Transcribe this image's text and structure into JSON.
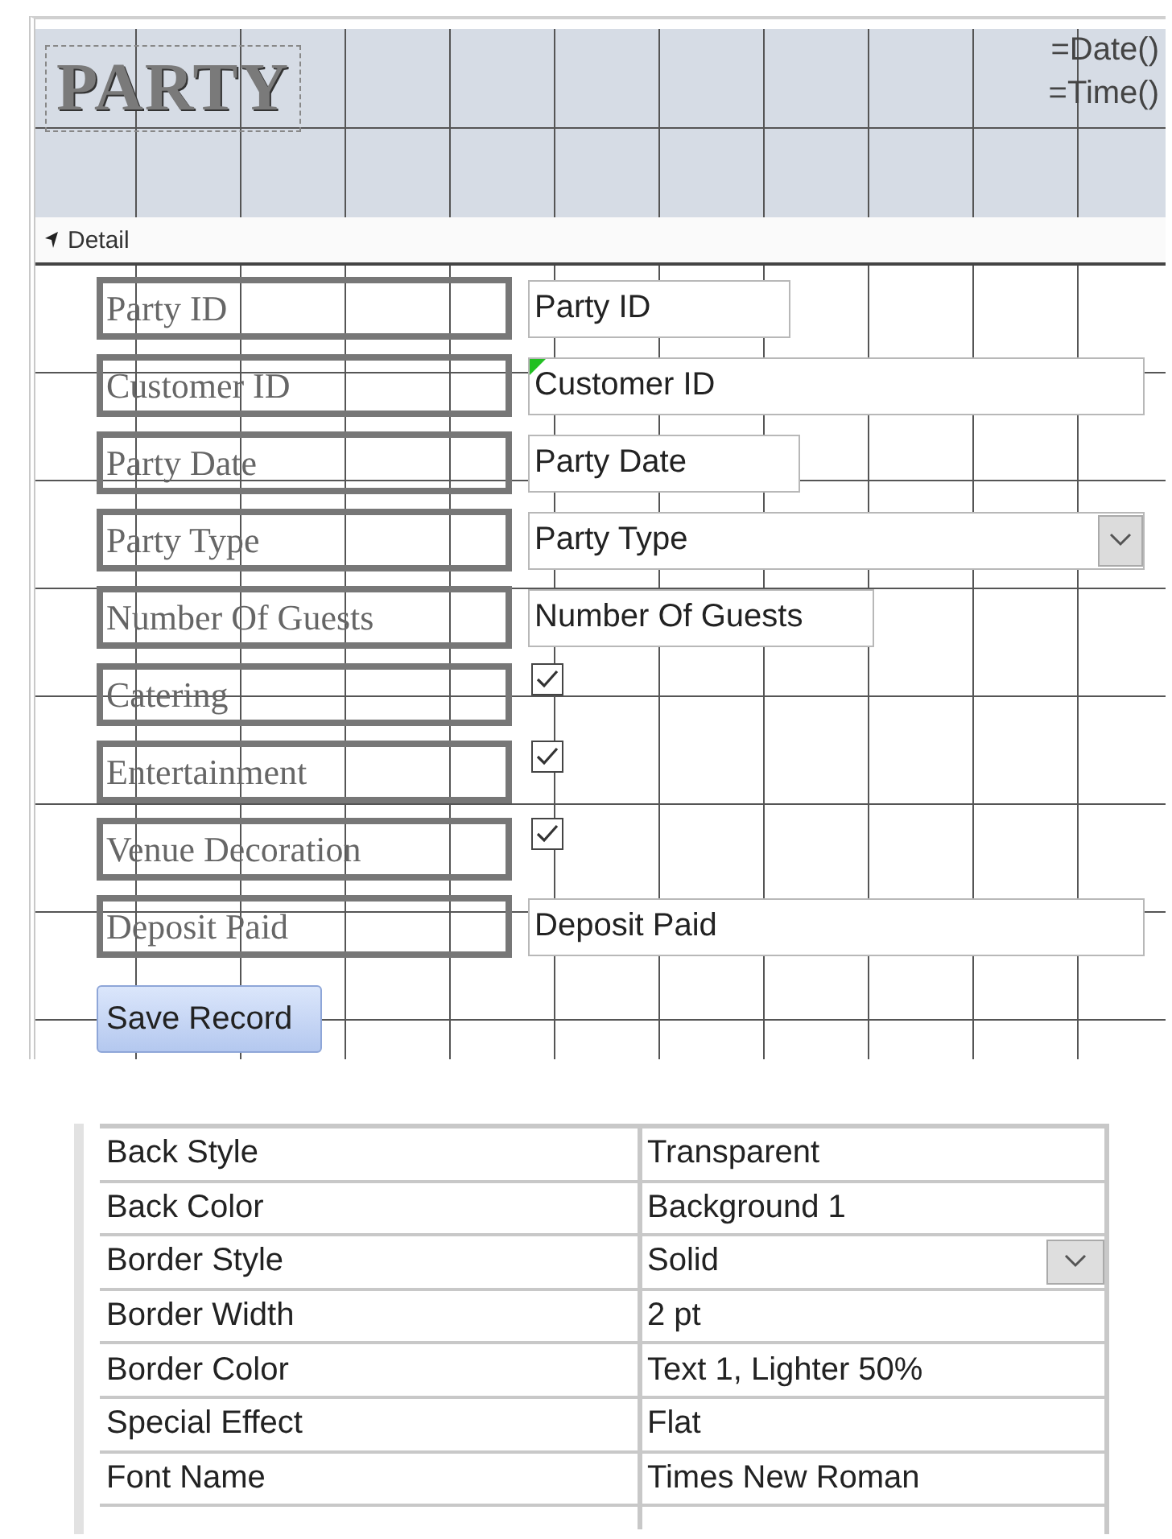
{
  "header": {
    "title": "PARTY",
    "expressions": [
      "=Date()",
      "=Time()"
    ]
  },
  "section": {
    "label": "Detail"
  },
  "fields": [
    {
      "label": "Party ID",
      "kind": "text",
      "value": "Party ID"
    },
    {
      "label": "Customer ID",
      "kind": "text",
      "value": "Customer ID",
      "error_flag": true
    },
    {
      "label": "Party Date",
      "kind": "text",
      "value": "Party Date"
    },
    {
      "label": "Party Type",
      "kind": "combo",
      "value": "Party Type"
    },
    {
      "label": "Number Of Guests",
      "kind": "text",
      "value": "Number Of Guests"
    },
    {
      "label": "Catering",
      "kind": "checkbox",
      "checked": true
    },
    {
      "label": "Entertainment",
      "kind": "checkbox",
      "checked": true
    },
    {
      "label": "Venue Decoration",
      "kind": "checkbox",
      "checked": true
    },
    {
      "label": "Deposit Paid",
      "kind": "text",
      "value": "Deposit Paid"
    }
  ],
  "button": {
    "label": "Save Record"
  },
  "properties": [
    {
      "name": "Back Style",
      "value": "Transparent"
    },
    {
      "name": "Back Color",
      "value": "Background 1"
    },
    {
      "name": "Border Style",
      "value": "Solid",
      "has_dropdown": true
    },
    {
      "name": "Border Width",
      "value": "2 pt"
    },
    {
      "name": "Border Color",
      "value": "Text 1, Lighter 50%"
    },
    {
      "name": "Special Effect",
      "value": "Flat"
    },
    {
      "name": "Font Name",
      "value": "Times New Roman"
    }
  ]
}
